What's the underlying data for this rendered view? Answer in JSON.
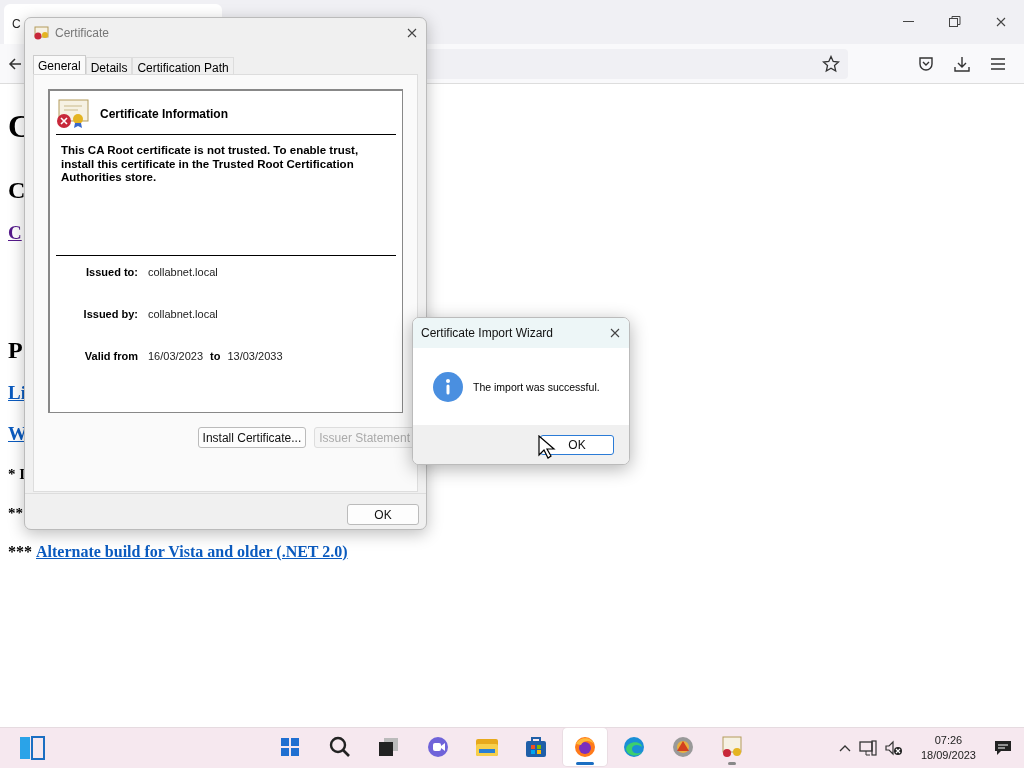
{
  "browser": {
    "tab_title": "C",
    "page_lines": [
      {
        "kind": "h1",
        "text": "C"
      },
      {
        "kind": "h2",
        "text": "C"
      },
      {
        "kind": "visited_link",
        "text": "C"
      },
      {
        "kind": "h2",
        "text": "P"
      },
      {
        "kind": "link",
        "text": "Li"
      },
      {
        "kind": "link",
        "text": "W"
      },
      {
        "kind": "bold",
        "text": "* I"
      },
      {
        "kind": "bold",
        "text": "**"
      },
      {
        "kind": "note",
        "prefix": "***",
        "text": "Alternate build for Vista and older (.NET 2.0)"
      }
    ]
  },
  "certificate_dialog": {
    "title": "Certificate",
    "tabs": [
      {
        "label": "General",
        "selected": true
      },
      {
        "label": "Details",
        "selected": false
      },
      {
        "label": "Certification Path",
        "selected": false
      }
    ],
    "heading": "Certificate Information",
    "message": "This CA Root certificate is not trusted. To enable trust, install this certificate in the Trusted Root Certification Authorities store.",
    "issued_to_label": "Issued to:",
    "issued_to": "collabnet.local",
    "issued_by_label": "Issued by:",
    "issued_by": "collabnet.local",
    "valid_from_label": "Valid from",
    "valid_from": "16/03/2023",
    "to_label": "to",
    "valid_to": "13/03/2033",
    "buttons": [
      {
        "label": "Install Certificate...",
        "disabled": false
      },
      {
        "label": "Issuer Statement",
        "disabled": true
      }
    ],
    "ok": "OK"
  },
  "import_wizard": {
    "title": "Certificate Import Wizard",
    "message": "The import was successful.",
    "ok": "OK"
  },
  "taskbar": {
    "apps": [
      {
        "active": false,
        "running": false
      },
      {
        "active": false,
        "running": false
      },
      {
        "active": false,
        "running": false
      },
      {
        "active": false,
        "running": false
      },
      {
        "active": false,
        "running": false
      },
      {
        "active": false,
        "running": false
      },
      {
        "active": true,
        "running": true
      },
      {
        "active": false,
        "running": false
      },
      {
        "active": false,
        "running": false
      },
      {
        "active": false,
        "running": true
      }
    ],
    "time": "07:26",
    "date": "18/09/2023"
  }
}
